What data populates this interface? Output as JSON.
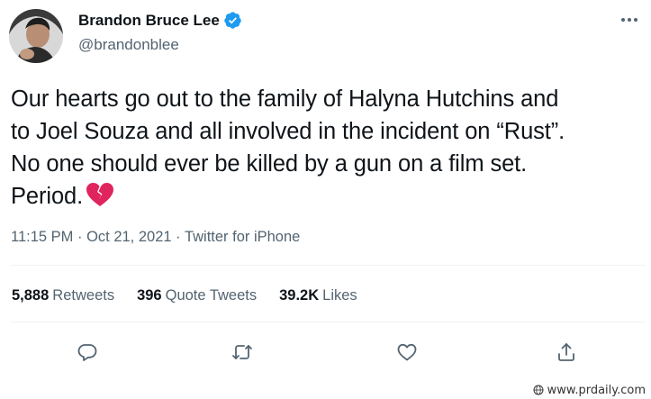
{
  "author": {
    "display_name": "Brandon Bruce Lee",
    "handle": "@brandonblee",
    "verified": true
  },
  "tweet": {
    "lines": [
      "Our hearts go out to the family of Halyna Hutchins and",
      "to Joel Souza and all involved in the incident on “Rust”.",
      "No one should ever be killed by a gun on a film set.",
      "Period."
    ],
    "emoji": "broken-heart"
  },
  "meta": {
    "time": "11:15 PM",
    "separator1": " · ",
    "date": "Oct 21, 2021",
    "separator2": " · ",
    "source": "Twitter for iPhone"
  },
  "stats": [
    {
      "value": "5,888",
      "label": "Retweets"
    },
    {
      "value": "396",
      "label": "Quote Tweets"
    },
    {
      "value": "39.2K",
      "label": "Likes"
    }
  ],
  "actions": [
    "reply-icon",
    "retweet-icon",
    "like-icon",
    "share-icon"
  ],
  "watermark": "www.prdaily.com",
  "colors": {
    "text": "#0f1419",
    "secondary": "#536471",
    "verified": "#1d9bf0",
    "divider": "#eff3f4",
    "heart": "#e0245e"
  }
}
